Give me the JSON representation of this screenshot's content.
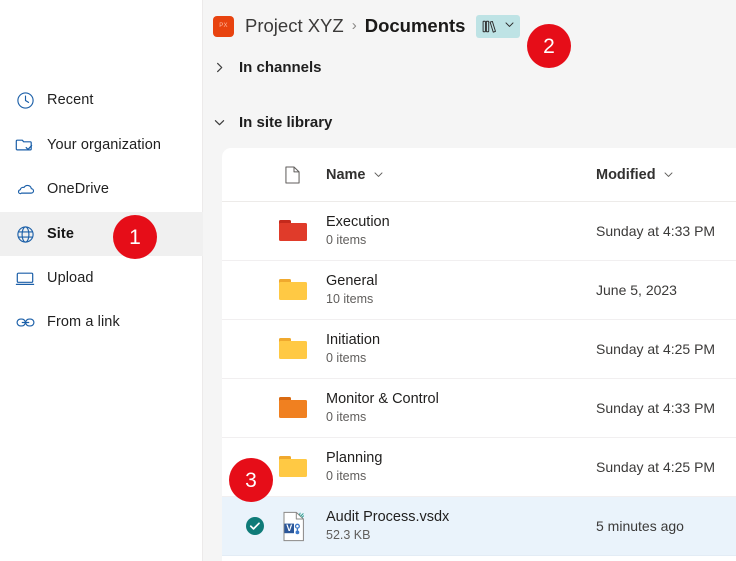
{
  "sidebar": {
    "items": [
      {
        "label": "Recent",
        "icon": "clock-icon",
        "selected": false
      },
      {
        "label": "Your organization",
        "icon": "folder-check-icon",
        "selected": false
      },
      {
        "label": "OneDrive",
        "icon": "onedrive-icon",
        "selected": false
      },
      {
        "label": "Site",
        "icon": "globe-icon",
        "selected": true
      },
      {
        "label": "Upload",
        "icon": "monitor-icon",
        "selected": false
      },
      {
        "label": "From a link",
        "icon": "link-icon",
        "selected": false
      }
    ]
  },
  "breadcrumb": {
    "avatar_initials": "PX",
    "team": "Project XYZ",
    "separator": "›",
    "current": "Documents",
    "library_icon": "library-books-icon",
    "library_chevron": "chevron-down-icon"
  },
  "sections": [
    {
      "label": "In channels",
      "expanded": false,
      "chevron": "chevron-right-icon"
    },
    {
      "label": "In site library",
      "expanded": true,
      "chevron": "chevron-down-icon"
    }
  ],
  "file_table": {
    "columns": {
      "icon_header": "document-icon",
      "name": "Name",
      "modified": "Modified",
      "sort_chevron": "chevron-down-icon"
    },
    "rows": [
      {
        "name": "Execution",
        "sub": "0 items",
        "modified": "Sunday at 4:33 PM",
        "icon": "folder-icon",
        "color": "#E03B2A",
        "tab_color": "#C4291C",
        "selected": false,
        "checked": false
      },
      {
        "name": "General",
        "sub": "10 items",
        "modified": "June 5, 2023",
        "icon": "folder-icon",
        "color": "#FFC944",
        "tab_color": "#F0A92E",
        "selected": false,
        "checked": false
      },
      {
        "name": "Initiation",
        "sub": "0 items",
        "modified": "Sunday at 4:25 PM",
        "icon": "folder-icon",
        "color": "#FFC944",
        "tab_color": "#F0A92E",
        "selected": false,
        "checked": false
      },
      {
        "name": "Monitor & Control",
        "sub": "0 items",
        "modified": "Sunday at 4:33 PM",
        "icon": "folder-icon",
        "color": "#F08020",
        "tab_color": "#D96A12",
        "selected": false,
        "checked": false
      },
      {
        "name": "Planning",
        "sub": "0 items",
        "modified": "Sunday at 4:25 PM",
        "icon": "folder-icon",
        "color": "#FFC944",
        "tab_color": "#F0A92E",
        "selected": false,
        "checked": false
      },
      {
        "name": "Audit Process.vsdx",
        "sub": "52.3 KB",
        "modified": "5 minutes ago",
        "icon": "visio-file-icon",
        "color": "",
        "tab_color": "",
        "selected": true,
        "checked": true
      }
    ]
  },
  "badges": [
    {
      "number": "1"
    },
    {
      "number": "2"
    },
    {
      "number": "3"
    }
  ],
  "colors": {
    "badge_red": "#E60D18",
    "selection_blue": "#eaf3fb",
    "check_teal": "#0F7B78",
    "library_pill": "#bee3e5",
    "avatar_orange": "#E8430F"
  }
}
